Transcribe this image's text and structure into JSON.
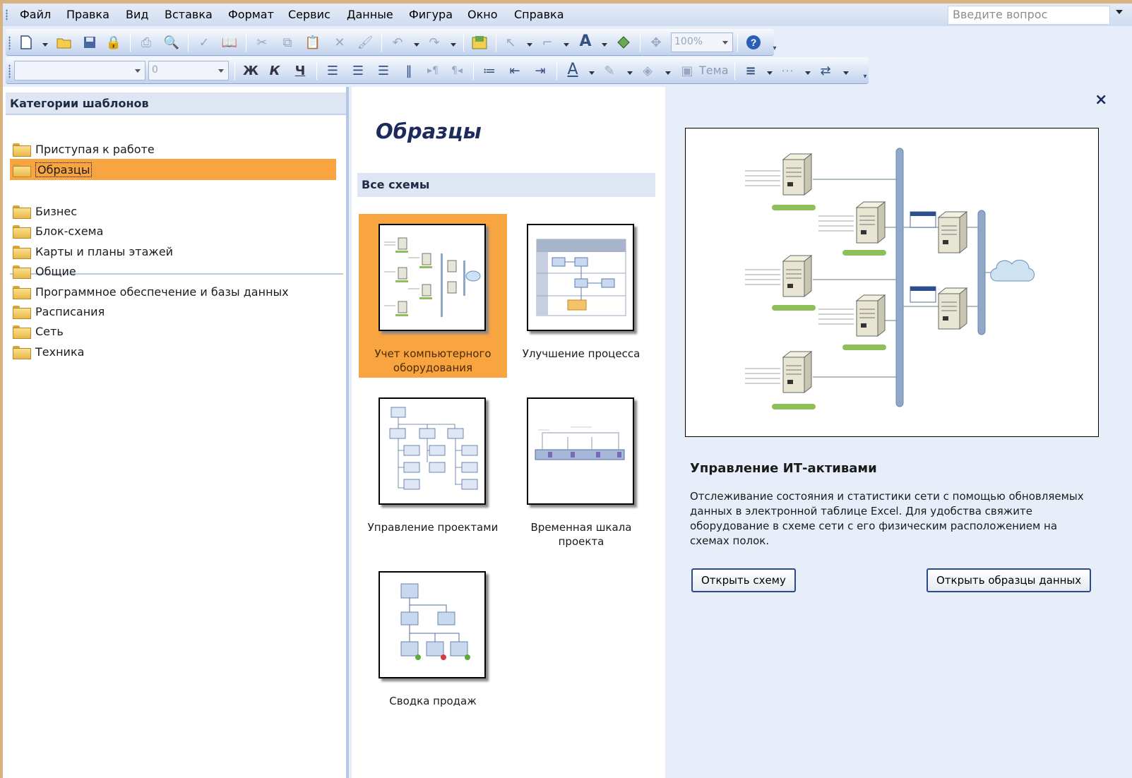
{
  "menubar": {
    "items": [
      "Файл",
      "Правка",
      "Вид",
      "Вставка",
      "Формат",
      "Сервис",
      "Данные",
      "Фигура",
      "Окно",
      "Справка"
    ],
    "help_placeholder": "Введите вопрос"
  },
  "toolbar": {
    "zoom_value": "100%",
    "font_size_value": "0",
    "bold_label": "Ж",
    "italic_label": "К",
    "underline_label": "Ч",
    "theme_label": "Тема"
  },
  "left": {
    "header": "Категории шаблонов",
    "top_items": [
      "Приступая к работе",
      "Образцы"
    ],
    "categories": [
      "Бизнес",
      "Блок-схема",
      "Карты и планы этажей",
      "Общие",
      "Программное обеспечение и базы данных",
      "Расписания",
      "Сеть",
      "Техника"
    ]
  },
  "middle": {
    "title": "Образцы",
    "section": "Все схемы",
    "tiles": [
      {
        "label": "Учет компьютерного оборудования"
      },
      {
        "label": "Улучшение процесса"
      },
      {
        "label": "Управление проектами"
      },
      {
        "label": "Временная шкала проекта"
      },
      {
        "label": "Сводка продаж"
      }
    ]
  },
  "right": {
    "close": "×",
    "title": "Управление ИТ-активами",
    "description": "Отслеживание состояния и статистики сети с помощью обновляемых данных в электронной таблице Excel. Для удобства свяжите оборудование в схеме сети с его физическим расположением на схемах полок.",
    "open_button": "Открыть схему",
    "open_data_button": "Открыть образцы данных"
  },
  "colors": {
    "selection": "#f7a441",
    "header_bg": "#dde6f2",
    "pane_bg": "#e7eefa"
  }
}
